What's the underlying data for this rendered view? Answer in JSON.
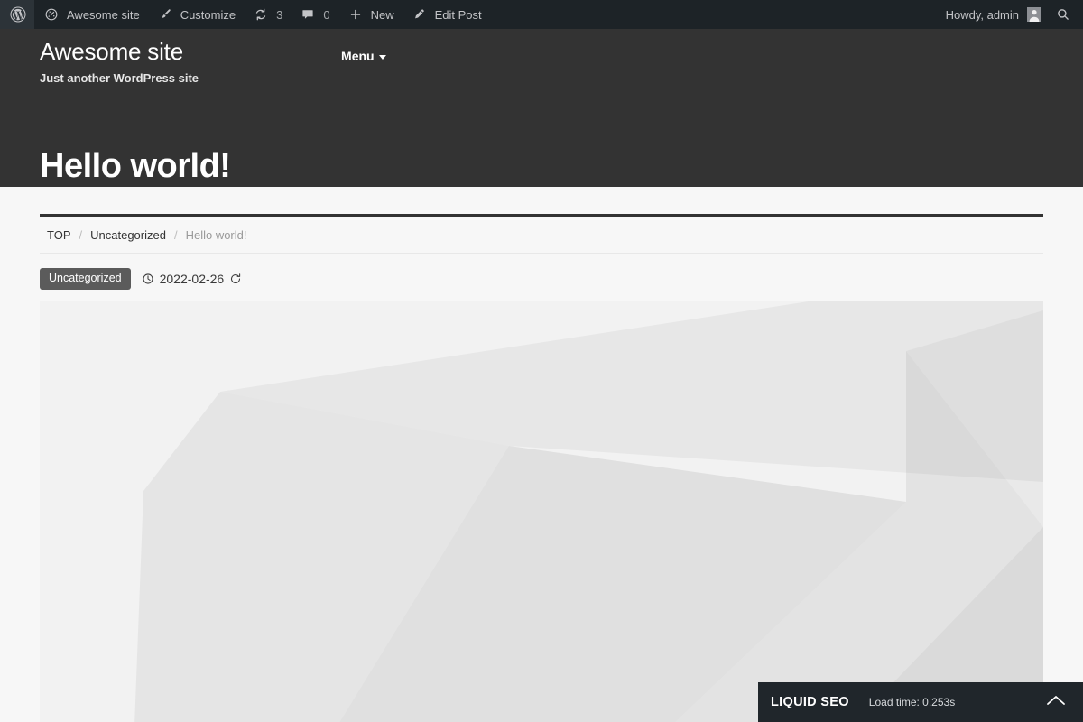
{
  "admin_bar": {
    "wp_logo": "wordpress-logo",
    "left_items": [
      {
        "icon": "dashboard-gauge-icon",
        "label": "Awesome site",
        "count": null
      },
      {
        "icon": "paintbrush-icon",
        "label": "Customize",
        "count": null
      },
      {
        "icon": "revisions-icon",
        "label": "",
        "count": "3"
      },
      {
        "icon": "comment-bubble-icon",
        "label": "",
        "count": "0"
      },
      {
        "icon": "plus-icon",
        "label": "New",
        "count": null
      },
      {
        "icon": "pencil-icon",
        "label": "Edit Post",
        "count": null
      }
    ],
    "howdy": "Howdy, admin",
    "avatar_alt": "admin-avatar",
    "search_icon": "search-icon",
    "bg_color": "#1d2327",
    "text_color": "#c3c4c7"
  },
  "site_header": {
    "title": "Awesome site",
    "description": "Just another WordPress site",
    "menu_label": "Menu",
    "page_title": "Hello world!",
    "bg_color": "#333333"
  },
  "breadcrumb": {
    "items": [
      {
        "label": "TOP",
        "current": false
      },
      {
        "label": "Uncategorized",
        "current": false
      },
      {
        "label": "Hello world!",
        "current": true
      }
    ],
    "separator": "/"
  },
  "post_meta": {
    "category": "Uncategorized",
    "category_bg": "#5b5b5b",
    "date": "2022-02-26",
    "clock_icon": "clock-icon",
    "updated_icon": "refresh-update-icon"
  },
  "featured_image": {
    "alt": "abstract-gray-polygon-placeholder",
    "base_color": "#f2f2f2"
  },
  "seo_bar": {
    "brand": "LIQUID SEO",
    "load_time_label": "Load time: 0.253s",
    "toggle_icon": "chevron-up-icon",
    "bg_color": "#20262b"
  }
}
